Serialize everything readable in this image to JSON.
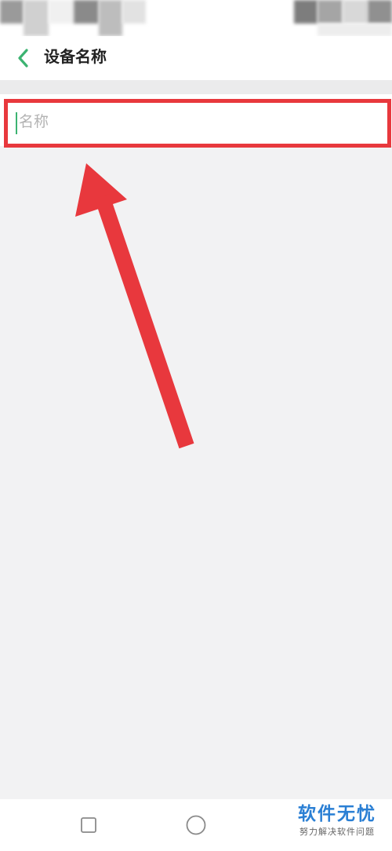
{
  "header": {
    "title": "设备名称",
    "back_icon": "chevron-left-icon"
  },
  "name_field": {
    "placeholder": "名称",
    "value": ""
  },
  "nav_bar": {
    "recent_icon": "square-icon",
    "home_icon": "circle-icon"
  },
  "watermark": {
    "title": "软件无忧",
    "subtitle": "努力解决软件问题"
  },
  "colors": {
    "accent": "#3cb371",
    "highlight": "#e8383d",
    "background": "#f2f2f3",
    "watermark_blue": "#2a7fd4"
  }
}
